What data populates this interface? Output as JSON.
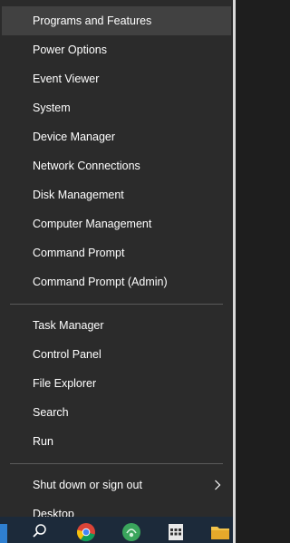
{
  "menu": {
    "group1": [
      {
        "label": "Programs and Features",
        "highlighted": true
      },
      {
        "label": "Power Options"
      },
      {
        "label": "Event Viewer"
      },
      {
        "label": "System"
      },
      {
        "label": "Device Manager"
      },
      {
        "label": "Network Connections"
      },
      {
        "label": "Disk Management"
      },
      {
        "label": "Computer Management"
      },
      {
        "label": "Command Prompt"
      },
      {
        "label": "Command Prompt (Admin)"
      }
    ],
    "group2": [
      {
        "label": "Task Manager"
      },
      {
        "label": "Control Panel"
      },
      {
        "label": "File Explorer"
      },
      {
        "label": "Search"
      },
      {
        "label": "Run"
      }
    ],
    "group3": [
      {
        "label": "Shut down or sign out",
        "has_submenu": true,
        "icon": "chevron-right-icon"
      },
      {
        "label": "Desktop"
      }
    ]
  },
  "taskbar": {
    "icons": [
      "start-icon",
      "search-icon",
      "chrome-icon",
      "green-app-icon",
      "calculator-icon",
      "file-explorer-icon"
    ]
  },
  "colors": {
    "menu_bg": "#2b2b2b",
    "highlight_bg": "#414141",
    "text": "#ffffff",
    "separator": "#5a5a5a",
    "taskbar_bg": "#1c2a3a"
  }
}
